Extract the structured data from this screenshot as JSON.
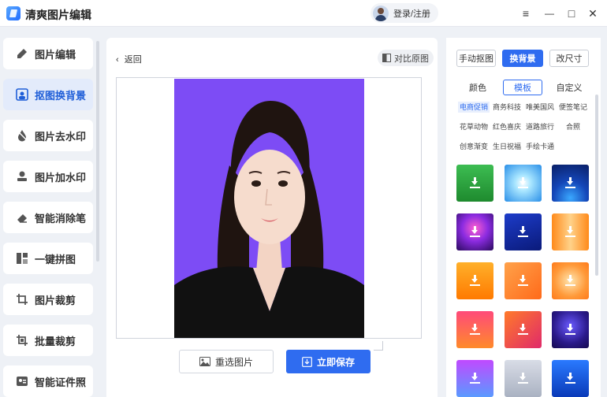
{
  "app": {
    "title": "清爽图片编辑",
    "login_label": "登录/注册"
  },
  "window_controls": {
    "menu": "≡",
    "minimize": "—",
    "maximize": "□",
    "close": "✕"
  },
  "sidebar": {
    "items": [
      {
        "label": "图片编辑",
        "icon": "pencil-icon"
      },
      {
        "label": "抠图换背景",
        "icon": "cutout-icon",
        "active": true
      },
      {
        "label": "图片去水印",
        "icon": "drop-icon"
      },
      {
        "label": "图片加水印",
        "icon": "stamp-icon"
      },
      {
        "label": "智能消除笔",
        "icon": "eraser-icon"
      },
      {
        "label": "一键拼图",
        "icon": "collage-icon"
      },
      {
        "label": "图片裁剪",
        "icon": "crop-icon"
      },
      {
        "label": "批量裁剪",
        "icon": "batch-crop-icon"
      },
      {
        "label": "智能证件照",
        "icon": "id-photo-icon"
      }
    ]
  },
  "editor": {
    "back_label": "返回",
    "compare_label": "对比原图",
    "background_color": "#7d4cf5",
    "reselect_label": "重选图片",
    "save_label": "立即保存"
  },
  "panel": {
    "mode_tabs": [
      {
        "label": "手动抠图"
      },
      {
        "label": "换背景",
        "active": true
      },
      {
        "label": "改尺寸"
      }
    ],
    "sub_tabs": [
      {
        "label": "颜色"
      },
      {
        "label": "模板",
        "active": true
      },
      {
        "label": "自定义"
      }
    ],
    "categories": [
      [
        {
          "label": "电商促销",
          "active": true
        },
        {
          "label": "商务科技"
        },
        {
          "label": "唯美国风"
        },
        {
          "label": "便签笔记"
        }
      ],
      [
        {
          "label": "花草动物"
        },
        {
          "label": "红色喜庆"
        },
        {
          "label": "道路旅行"
        },
        {
          "label": "合照"
        }
      ],
      [
        {
          "label": "创意渐变"
        },
        {
          "label": "生日祝福"
        },
        {
          "label": "手绘卡通"
        }
      ]
    ]
  }
}
